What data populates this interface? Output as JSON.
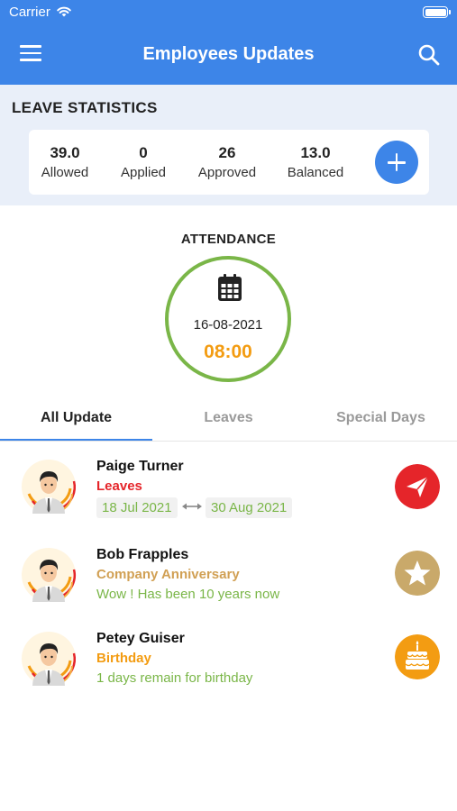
{
  "status_bar": {
    "carrier": "Carrier"
  },
  "header": {
    "title": "Employees Updates"
  },
  "leave_stats": {
    "heading": "LEAVE STATISTICS",
    "items": [
      {
        "value": "39.0",
        "label": "Allowed"
      },
      {
        "value": "0",
        "label": "Applied"
      },
      {
        "value": "26",
        "label": "Approved"
      },
      {
        "value": "13.0",
        "label": "Balanced"
      }
    ]
  },
  "attendance": {
    "heading": "ATTENDANCE",
    "date": "16-08-2021",
    "time": "08:00"
  },
  "tabs": [
    {
      "label": "All Update",
      "active": true
    },
    {
      "label": "Leaves",
      "active": false
    },
    {
      "label": "Special Days",
      "active": false
    }
  ],
  "updates": [
    {
      "name": "Paige Turner",
      "type": "Leaves",
      "type_color": "#e5252a",
      "from": "18 Jul 2021",
      "to": "30 Aug 2021",
      "icon": "paper-plane-icon",
      "icon_bg": "#e5252a"
    },
    {
      "name": "Bob Frapples",
      "type": "Company Anniversary",
      "type_color": "#d1a054",
      "detail": "Wow ! Has been 10 years now",
      "icon": "star-icon",
      "icon_bg": "#c9a96a"
    },
    {
      "name": "Petey Guiser",
      "type": "Birthday",
      "type_color": "#f39c12",
      "detail": "1 days remain for birthday",
      "icon": "cake-icon",
      "icon_bg": "#f39c12"
    }
  ],
  "colors": {
    "primary": "#3d85e8",
    "accent_green": "#7ab648",
    "accent_orange": "#f39c12"
  }
}
